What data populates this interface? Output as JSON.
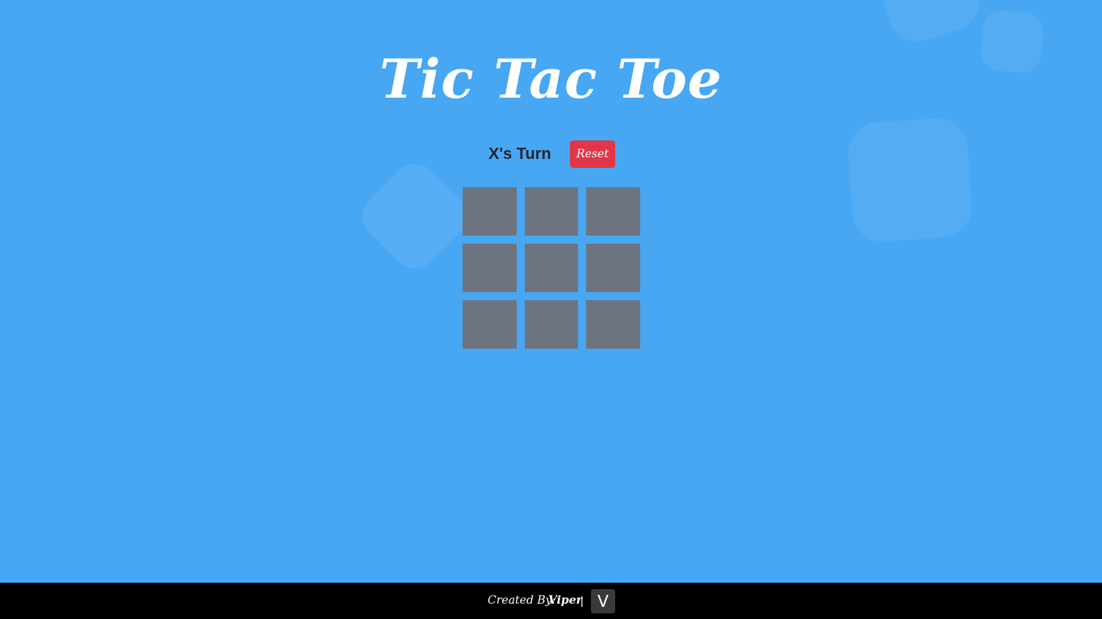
{
  "header": {
    "title": "Tic Tac Toe"
  },
  "status": {
    "turn_text": "X's Turn",
    "reset_label": "Reset"
  },
  "board": {
    "cells": [
      "",
      "",
      "",
      "",
      "",
      "",
      "",
      "",
      ""
    ]
  },
  "footer": {
    "credit_label": "Created By:",
    "author": "Viper",
    "separator": "|",
    "logo_letter": "V"
  },
  "colors": {
    "background": "#47a7f3",
    "cell": "#6d747e",
    "reset_button": "#e33548",
    "footer": "#000000",
    "logo_badge": "#3a3a3a"
  }
}
